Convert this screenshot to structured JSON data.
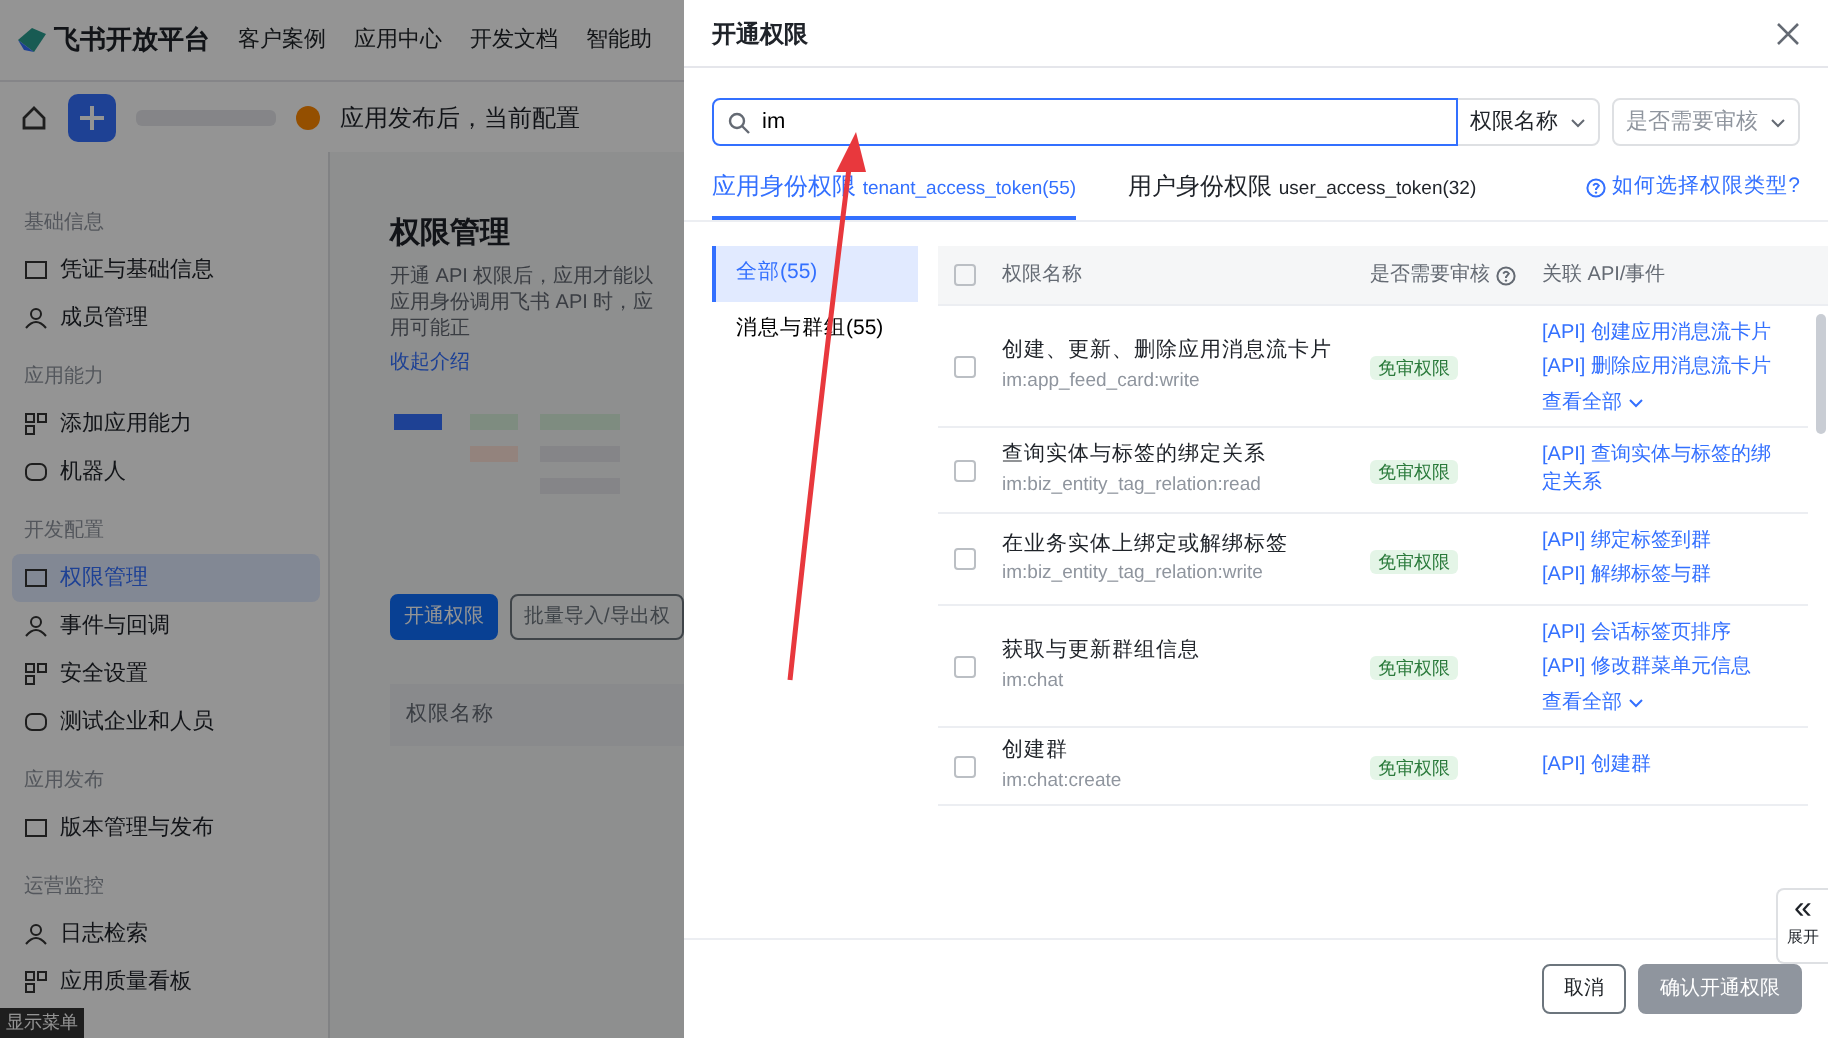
{
  "background_page": {
    "logo": "飞书开放平台",
    "nav": [
      "客户案例",
      "应用中心",
      "开发文档",
      "智能助"
    ],
    "notice": "应用发布后，当前配置",
    "sidebar": [
      {
        "title": "基础信息",
        "items": [
          {
            "label": "凭证与基础信息",
            "selected": false
          },
          {
            "label": "成员管理",
            "selected": false
          }
        ]
      },
      {
        "title": "应用能力",
        "items": [
          {
            "label": "添加应用能力",
            "selected": false
          },
          {
            "label": "机器人",
            "selected": false
          }
        ]
      },
      {
        "title": "开发配置",
        "items": [
          {
            "label": "权限管理",
            "selected": true
          },
          {
            "label": "事件与回调",
            "selected": false
          },
          {
            "label": "安全设置",
            "selected": false
          },
          {
            "label": "测试企业和人员",
            "selected": false
          }
        ]
      },
      {
        "title": "应用发布",
        "items": [
          {
            "label": "版本管理与发布",
            "selected": false
          }
        ]
      },
      {
        "title": "运营监控",
        "items": [
          {
            "label": "日志检索",
            "selected": false
          },
          {
            "label": "应用质量看板",
            "selected": false
          }
        ]
      }
    ],
    "show_menu": "显示菜单",
    "title": "权限管理",
    "description": "开通 API 权限后，应用才能以应用身份调用飞书 API 时，应用可能正",
    "collapse_link": "收起介绍",
    "buttons": [
      {
        "label": "开通权限",
        "kind": "primary"
      },
      {
        "label": "批量导入/导出权",
        "kind": "outline"
      }
    ],
    "table_header": "权限名称"
  },
  "drawer": {
    "title": "开通权限",
    "search": {
      "value": "im"
    },
    "filters": [
      {
        "value": "权限名称",
        "placeholder": false
      },
      {
        "value": "是否需要审核",
        "placeholder": true
      }
    ],
    "tabs": [
      {
        "label": "应用身份权限",
        "token": "tenant_access_token(55)",
        "selected": true
      },
      {
        "label": "用户身份权限",
        "token": "user_access_token(32)",
        "selected": false
      }
    ],
    "help_link": "如何选择权限类型?",
    "categories": [
      {
        "label": "全部(55)",
        "selected": true
      },
      {
        "label": "消息与群组(55)",
        "selected": false
      }
    ],
    "select_all": {
      "checked": false
    },
    "columns": [
      "权限名称",
      "是否需要审核",
      "关联 API/事件"
    ],
    "rows": [
      {
        "name": "创建、更新、删除应用消息流卡片",
        "scope": "im:app_feed_card:write",
        "review": "免审权限",
        "apis": [
          "[API] 创建应用消息流卡片",
          "[API] 删除应用消息流卡片"
        ],
        "more": "查看全部",
        "checked": false
      },
      {
        "name": "查询实体与标签的绑定关系",
        "scope": "im:biz_entity_tag_relation:read",
        "review": "免审权限",
        "apis": [
          "[API] 查询实体与标签的绑定关系"
        ],
        "checked": false
      },
      {
        "name": "在业务实体上绑定或解绑标签",
        "scope": "im:biz_entity_tag_relation:write",
        "review": "免审权限",
        "apis": [
          "[API] 绑定标签到群",
          "[API] 解绑标签与群"
        ],
        "checked": false
      },
      {
        "name": "获取与更新群组信息",
        "scope": "im:chat",
        "review": "免审权限",
        "apis": [
          "[API] 会话标签页排序",
          "[API] 修改群菜单元信息"
        ],
        "more": "查看全部",
        "checked": false
      },
      {
        "name": "创建群",
        "scope": "im:chat:create",
        "review": "免审权限",
        "apis": [
          "[API] 创建群"
        ],
        "checked": false
      }
    ],
    "expand_tab": "展开",
    "expand_icon": "«",
    "cancel": "取消",
    "confirm": {
      "label": "确认开通权限",
      "disabled": true
    }
  }
}
